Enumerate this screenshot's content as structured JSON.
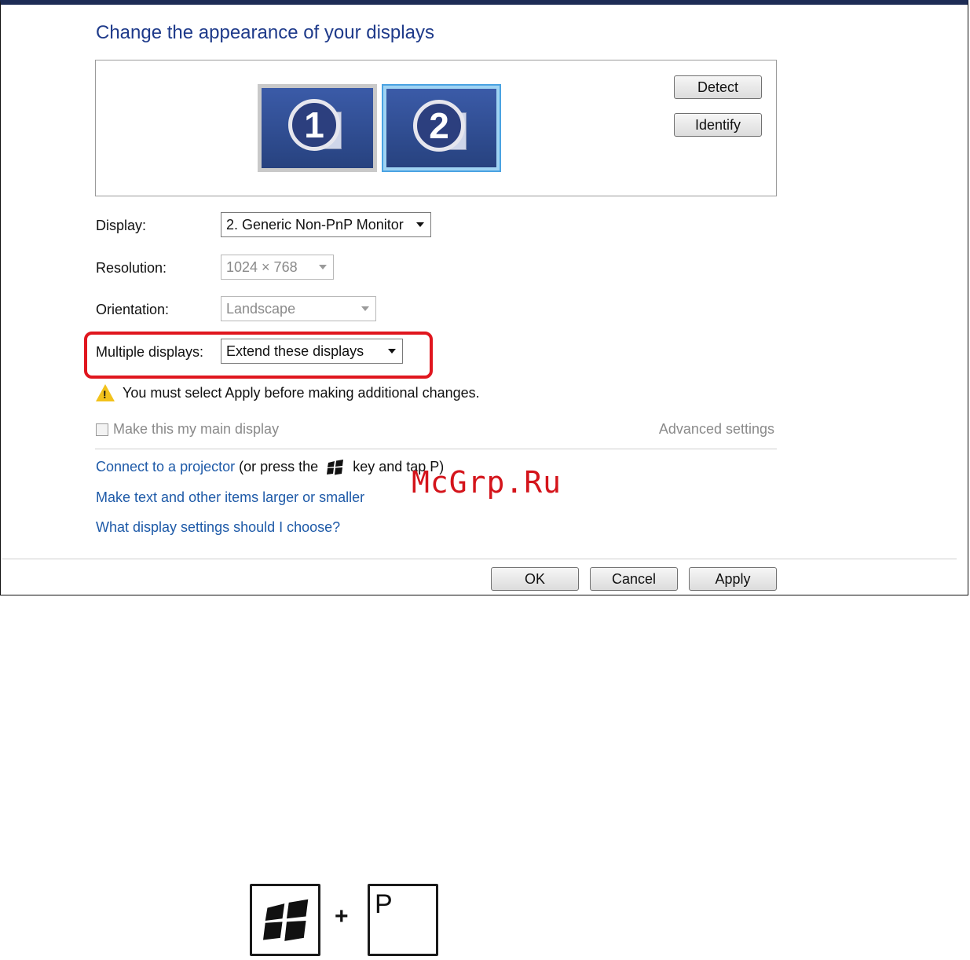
{
  "window": {
    "title": "Change the appearance of your displays",
    "monitors": [
      {
        "number": "1"
      },
      {
        "number": "2"
      }
    ],
    "detect_label": "Detect",
    "identify_label": "Identify"
  },
  "form": {
    "display_label": "Display:",
    "display_value": "2. Generic Non-PnP Monitor",
    "resolution_label": "Resolution:",
    "resolution_value": "1024 × 768",
    "orientation_label": "Orientation:",
    "orientation_value": "Landscape",
    "multiple_label": "Multiple displays:",
    "multiple_value": "Extend these displays"
  },
  "warning": "You must select Apply before making additional changes.",
  "main_display_label": "Make this my main display",
  "advanced_label": "Advanced settings",
  "links": {
    "projector": "Connect to a projector",
    "projector_suffix_a": "(or press the",
    "projector_suffix_b": "key and tap P)",
    "text_size": "Make text and other items larger or smaller",
    "which_settings": "What display settings should I choose?"
  },
  "buttons": {
    "ok": "OK",
    "cancel": "Cancel",
    "apply": "Apply"
  },
  "watermark": "McGrp.Ru",
  "shortcut": {
    "plus": "+",
    "key_p": "P"
  },
  "colors": {
    "link": "#1e5aa8",
    "highlight": "#e0161e",
    "title": "#1e3a8a"
  }
}
